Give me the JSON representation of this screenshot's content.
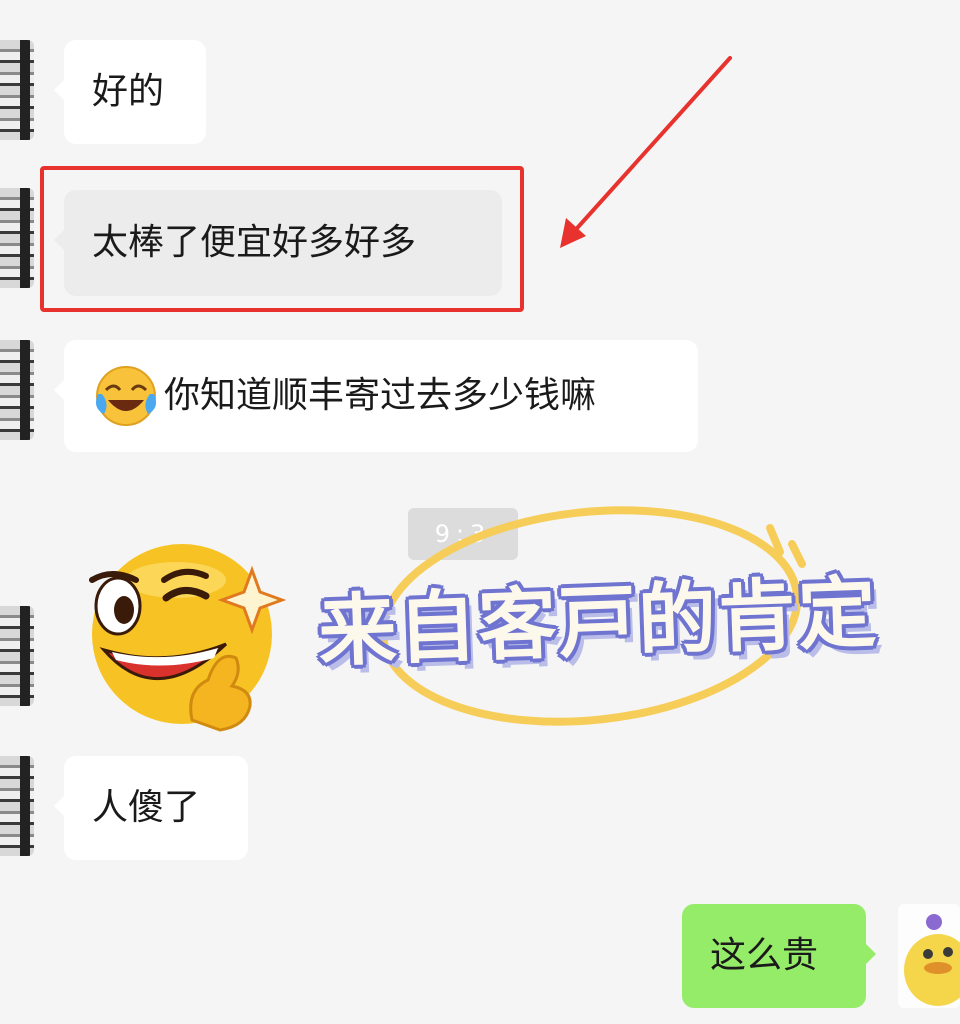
{
  "messages": [
    {
      "text": "好的"
    },
    {
      "text": "太棒了便宜好多好多"
    },
    {
      "text": "你知道顺丰寄过去多少钱嘛",
      "emoji": "laughing-tears-emoji"
    },
    {
      "sticker": "winking-thumbs-sticker"
    },
    {
      "text": "人傻了"
    },
    {
      "text": "这么贵",
      "mine": true
    }
  ],
  "timestamp": "9:3",
  "overlay": {
    "stamp_text": "来自客戸的肯定"
  },
  "colors": {
    "highlight": "#e8322d",
    "arrow": "#e8322d",
    "my_bubble": "#95ec69",
    "stamp_outline": "#6f74d0",
    "stamp_ring": "#f7cd5a"
  }
}
